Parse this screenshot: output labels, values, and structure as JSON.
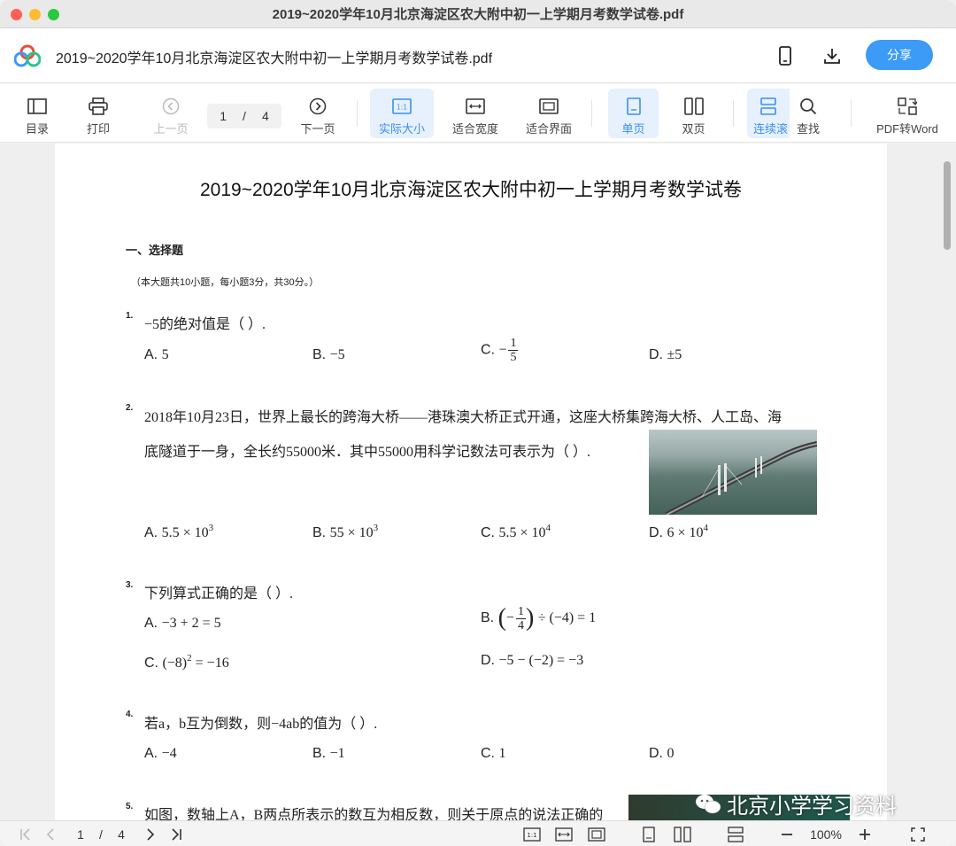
{
  "window": {
    "title": "2019~2020学年10月北京海淀区农大附中初一上学期月考数学试卷.pdf"
  },
  "header": {
    "doc_title": "2019~2020学年10月北京海淀区农大附中初一上学期月考数学试卷.pdf",
    "share_label": "分享",
    "icons": [
      "phone-icon",
      "download-icon"
    ]
  },
  "toolbar": {
    "toc": "目录",
    "print": "打印",
    "prev": "上一页",
    "current_page": "1",
    "page_sep": "/",
    "total_pages": "4",
    "next": "下一页",
    "actual_size": "实际大小",
    "fit_width": "适合宽度",
    "fit_screen": "适合界面",
    "single": "单页",
    "double": "双页",
    "continuous": "连续滚",
    "find": "查找",
    "to_word": "PDF转Word"
  },
  "page": {
    "title": "2019~2020学年10月北京海淀区农大附中初一上学期月考数学试卷",
    "section": "一、选择题",
    "note": "（本大题共10小题，每小题3分，共30分。）",
    "questions": [
      {
        "num": "1.",
        "text": "−5的绝对值是（ ）.",
        "options": {
          "a": "A.",
          "a_val": "5",
          "b": "B.",
          "b_val": "−5",
          "c": "C.",
          "c_val": "−",
          "c_num": "1",
          "c_den": "5",
          "d": "D.",
          "d_val": "±5"
        }
      },
      {
        "num": "2.",
        "line1": "2018年10月23日，世界上最长的跨海大桥——港珠澳大桥正式开通，这座大桥集跨海大桥、人工岛、海",
        "line2": "底隧道于一身，全长约55000米．其中55000用科学记数法可表示为（ ）.",
        "options": {
          "a": "A.",
          "a_val": "5.5 × 10",
          "a_exp": "3",
          "b": "B.",
          "b_val": "55 × 10",
          "b_exp": "3",
          "c": "C.",
          "c_val": "5.5 × 10",
          "c_exp": "4",
          "d": "D.",
          "d_val": "6 × 10",
          "d_exp": "4"
        }
      },
      {
        "num": "3.",
        "text": "下列算式正确的是（ ）.",
        "options": {
          "a": "A.",
          "a_val": "−3 + 2 = 5",
          "b": "B.",
          "b_pre": "−",
          "b_num": "1",
          "b_den": "4",
          "b_post": "÷ (−4) = 1",
          "c": "C.",
          "c_val": "(−8)",
          "c_exp": "2",
          "c_post": " = −16",
          "d": "D.",
          "d_val": "−5 − (−2) = −3"
        }
      },
      {
        "num": "4.",
        "text": "若a，b互为倒数，则−4ab的值为（ ）.",
        "options": {
          "a": "A.",
          "a_val": "−4",
          "b": "B.",
          "b_val": "−1",
          "c": "C.",
          "c_val": "1",
          "d": "D.",
          "d_val": "0"
        }
      },
      {
        "num": "5.",
        "text": "如图，数轴上A，B两点所表示的数互为相反数，则关于原点的说法正确的"
      }
    ]
  },
  "watermark": "北京小学学习资料",
  "bottombar": {
    "page": "1",
    "sep": "/",
    "total": "4",
    "zoom": "100%"
  }
}
